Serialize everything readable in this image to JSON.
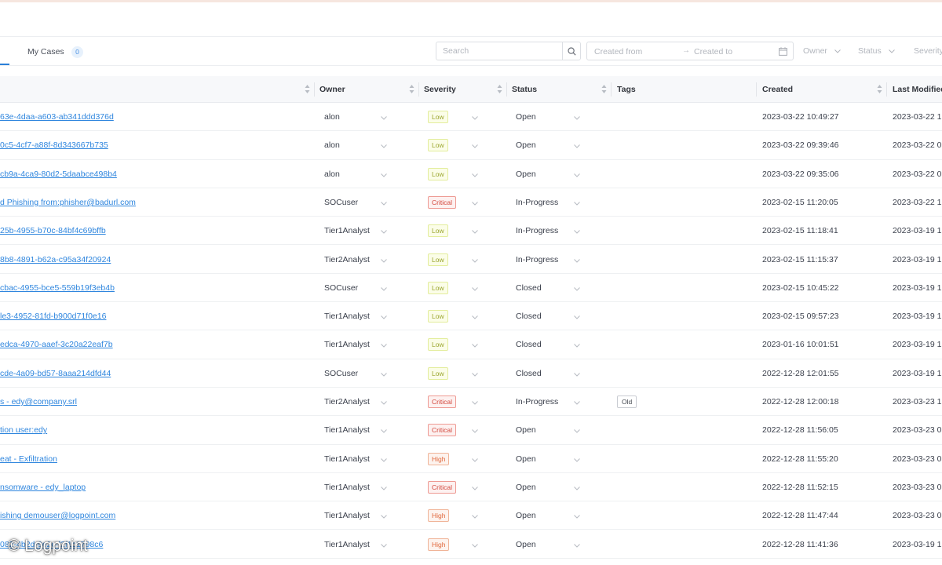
{
  "toolbar": {
    "tab_label": "My Cases",
    "tab_count": "0",
    "search_placeholder": "Search",
    "date_from": "Created from",
    "date_arrow": "→",
    "date_to": "Created to",
    "filters": [
      "Owner",
      "Status",
      "Severity"
    ]
  },
  "columns": {
    "owner": "Owner",
    "severity": "Severity",
    "status": "Status",
    "tags": "Tags",
    "created": "Created",
    "last_modified": "Last Modified"
  },
  "rows": [
    {
      "name": "63e-4daa-a603-ab341ddd376d",
      "owner": "alon",
      "severity": "Low",
      "status": "Open",
      "tag": "",
      "created": "2023-03-22 10:49:27",
      "modified": "2023-03-22 1"
    },
    {
      "name": "0c5-4cf7-a88f-8d343667b735",
      "owner": "alon",
      "severity": "Low",
      "status": "Open",
      "tag": "",
      "created": "2023-03-22 09:39:46",
      "modified": "2023-03-22 0"
    },
    {
      "name": "cb9a-4ca9-80d2-5daabce498b4",
      "owner": "alon",
      "severity": "Low",
      "status": "Open",
      "tag": "",
      "created": "2023-03-22 09:35:06",
      "modified": "2023-03-22 0"
    },
    {
      "name": "d Phishing from:phisher@badurl.com",
      "owner": "SOCuser",
      "severity": "Critical",
      "status": "In-Progress",
      "tag": "",
      "created": "2023-02-15 11:20:05",
      "modified": "2023-03-22 1"
    },
    {
      "name": "25b-4955-b70c-84bf4c69bffb",
      "owner": "Tier1Analyst",
      "severity": "Low",
      "status": "In-Progress",
      "tag": "",
      "created": "2023-02-15 11:18:41",
      "modified": "2023-03-19 1"
    },
    {
      "name": "8b8-4891-b62a-c95a34f20924",
      "owner": "Tier2Analyst",
      "severity": "Low",
      "status": "In-Progress",
      "tag": "",
      "created": "2023-02-15 11:15:37",
      "modified": "2023-03-19 1"
    },
    {
      "name": "cbac-4955-bce5-559b19f3eb4b",
      "owner": "SOCuser",
      "severity": "Low",
      "status": "Closed",
      "tag": "",
      "created": "2023-02-15 10:45:22",
      "modified": "2023-03-19 1"
    },
    {
      "name": "le3-4952-81fd-b900d71f0e16",
      "owner": "Tier1Analyst",
      "severity": "Low",
      "status": "Closed",
      "tag": "",
      "created": "2023-02-15 09:57:23",
      "modified": "2023-03-19 1"
    },
    {
      "name": "edca-4970-aaef-3c20a22eaf7b",
      "owner": "Tier1Analyst",
      "severity": "Low",
      "status": "Closed",
      "tag": "",
      "created": "2023-01-16 10:01:51",
      "modified": "2023-03-19 1"
    },
    {
      "name": "cde-4a09-bd57-8aaa214dfd44",
      "owner": "SOCuser",
      "severity": "Low",
      "status": "Closed",
      "tag": "",
      "created": "2022-12-28 12:01:55",
      "modified": "2023-03-19 1"
    },
    {
      "name": "s - edy@company.srl",
      "owner": "Tier2Analyst",
      "severity": "Critical",
      "status": "In-Progress",
      "tag": "Old",
      "created": "2022-12-28 12:00:18",
      "modified": "2023-03-23 1"
    },
    {
      "name": "tion user:edy",
      "owner": "Tier1Analyst",
      "severity": "Critical",
      "status": "Open",
      "tag": "",
      "created": "2022-12-28 11:56:05",
      "modified": "2023-03-23 0"
    },
    {
      "name": "eat - Exfiltration",
      "owner": "Tier1Analyst",
      "severity": "High",
      "status": "Open",
      "tag": "",
      "created": "2022-12-28 11:55:20",
      "modified": "2023-03-23 0"
    },
    {
      "name": "nsomware - edy_laptop",
      "owner": "Tier1Analyst",
      "severity": "Critical",
      "status": "Open",
      "tag": "",
      "created": "2022-12-28 11:52:15",
      "modified": "2023-03-23 0"
    },
    {
      "name": "ishing demouser@logpoint.com",
      "owner": "Tier1Analyst",
      "severity": "High",
      "status": "Open",
      "tag": "",
      "created": "2022-12-28 11:47:44",
      "modified": "2023-03-23 0"
    },
    {
      "name": "082-4b2d-9e2c-f2f1c1798c6",
      "owner": "Tier1Analyst",
      "severity": "High",
      "status": "Open",
      "tag": "",
      "created": "2022-12-28 11:41:36",
      "modified": "2023-03-19 1"
    }
  ],
  "watermark": "© Logpoint"
}
